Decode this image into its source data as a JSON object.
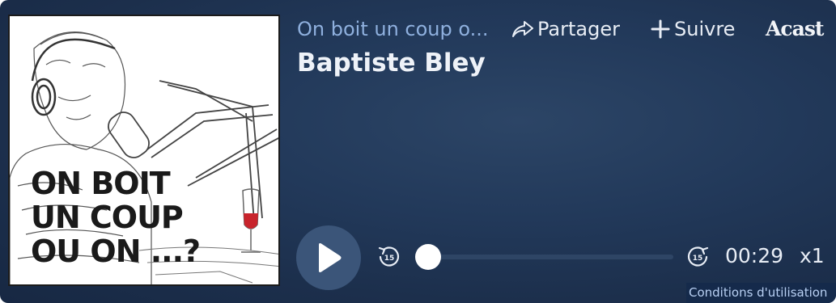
{
  "player": {
    "show_title": "On boit un coup o...",
    "episode_title": "Baptiste Bley",
    "share_label": "Partager",
    "follow_label": "Suivre",
    "brand": "Acast",
    "current_time": "00:29",
    "speed": "x1",
    "progress_fraction": 0.04,
    "skip_seconds": "15",
    "terms_link": "Conditions d'utilisation"
  },
  "cover": {
    "lines": [
      "ON BOIT",
      "UN COUP",
      "OU ON ...?"
    ]
  },
  "icons": [
    "share-icon",
    "plus-icon",
    "play-icon",
    "rewind-15-icon",
    "forward-15-icon"
  ],
  "colors": {
    "background": "#1f3454",
    "show_title": "#8fb0de",
    "text": "#e8edf5",
    "play_button": "#3b5579",
    "wine": "#c8242c"
  }
}
